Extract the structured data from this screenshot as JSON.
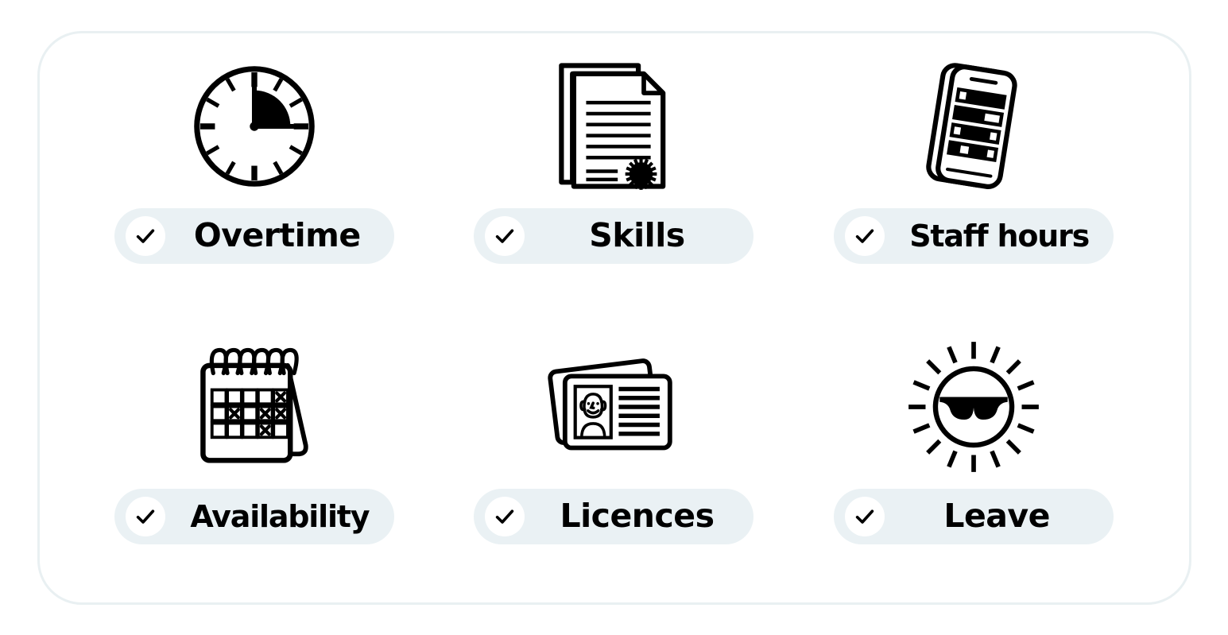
{
  "card": {
    "border_color": "#e9f0f2",
    "background": "#ffffff"
  },
  "styles": {
    "pill_background": "#eaf1f4",
    "check_circle_background": "#ffffff",
    "icon_color": "#000000",
    "label_color": "#000000"
  },
  "features": [
    {
      "id": "overtime",
      "label": "Overtime",
      "icon": "clock-icon",
      "checked": true,
      "check_glyph": "check-icon"
    },
    {
      "id": "skills",
      "label": "Skills",
      "icon": "certificate-documents-icon",
      "checked": true,
      "check_glyph": "check-icon"
    },
    {
      "id": "staff-hours",
      "label": "Staff hours",
      "icon": "mobile-timesheet-icon",
      "checked": true,
      "check_glyph": "check-icon"
    },
    {
      "id": "availability",
      "label": "Availability",
      "icon": "desk-calendar-icon",
      "checked": true,
      "check_glyph": "check-icon"
    },
    {
      "id": "licences",
      "label": "Licences",
      "icon": "id-card-icon",
      "checked": true,
      "check_glyph": "check-icon"
    },
    {
      "id": "leave",
      "label": "Leave",
      "icon": "sun-sunglasses-icon",
      "checked": true,
      "check_glyph": "check-icon"
    }
  ]
}
